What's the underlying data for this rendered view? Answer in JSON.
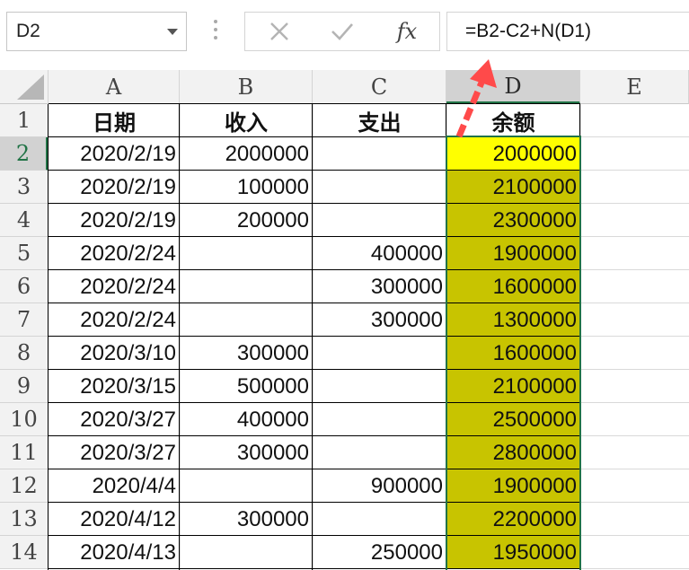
{
  "name_box": {
    "value": "D2"
  },
  "formula_bar": {
    "cancel_icon": "close-icon",
    "enter_icon": "check-icon",
    "fx_label": "fx",
    "formula": "=B2-C2+N(D1)"
  },
  "columns": [
    "A",
    "B",
    "C",
    "D",
    "E"
  ],
  "selected_column": "D",
  "header_row": {
    "row": "1",
    "a": "日期",
    "b": "收入",
    "c": "支出",
    "d": "余额"
  },
  "rows": [
    {
      "row": "2",
      "date": "2020/2/19",
      "income": "2000000",
      "expense": "",
      "balance": "2000000"
    },
    {
      "row": "3",
      "date": "2020/2/19",
      "income": "100000",
      "expense": "",
      "balance": "2100000"
    },
    {
      "row": "4",
      "date": "2020/2/19",
      "income": "200000",
      "expense": "",
      "balance": "2300000"
    },
    {
      "row": "5",
      "date": "2020/2/24",
      "income": "",
      "expense": "400000",
      "balance": "1900000"
    },
    {
      "row": "6",
      "date": "2020/2/24",
      "income": "",
      "expense": "300000",
      "balance": "1600000"
    },
    {
      "row": "7",
      "date": "2020/2/24",
      "income": "",
      "expense": "300000",
      "balance": "1300000"
    },
    {
      "row": "8",
      "date": "2020/3/10",
      "income": "300000",
      "expense": "",
      "balance": "1600000"
    },
    {
      "row": "9",
      "date": "2020/3/15",
      "income": "500000",
      "expense": "",
      "balance": "2100000"
    },
    {
      "row": "10",
      "date": "2020/3/27",
      "income": "400000",
      "expense": "",
      "balance": "2500000"
    },
    {
      "row": "11",
      "date": "2020/3/27",
      "income": "300000",
      "expense": "",
      "balance": "2800000"
    },
    {
      "row": "12",
      "date": "2020/4/4",
      "income": "",
      "expense": "900000",
      "balance": "1900000"
    },
    {
      "row": "13",
      "date": "2020/4/12",
      "income": "300000",
      "expense": "",
      "balance": "2200000"
    },
    {
      "row": "14",
      "date": "2020/4/13",
      "income": "",
      "expense": "250000",
      "balance": "1950000"
    }
  ],
  "colors": {
    "active_cell": "#ffff00",
    "balance_fill": "#c8c400",
    "selection": "#217346",
    "arrow": "#ff4a4a"
  }
}
